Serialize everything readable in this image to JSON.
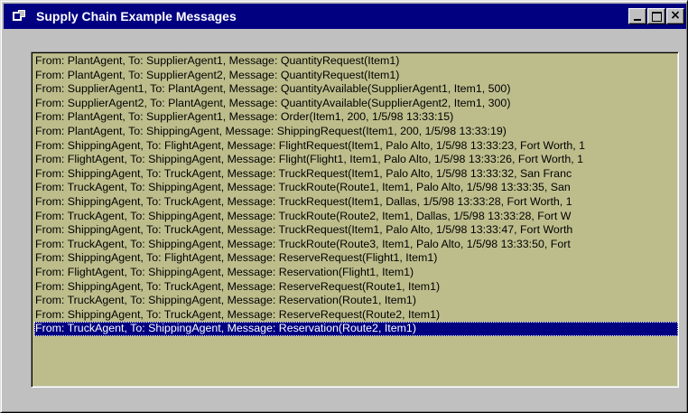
{
  "window": {
    "title": "Supply Chain Example Messages",
    "controls": {
      "minimize": "minimize-icon",
      "maximize": "maximize-icon",
      "close": "close-icon"
    }
  },
  "messages": [
    "From: PlantAgent, To: SupplierAgent1, Message: QuantityRequest(Item1)",
    "From: PlantAgent, To: SupplierAgent2, Message: QuantityRequest(Item1)",
    "From: SupplierAgent1, To: PlantAgent, Message: QuantityAvailable(SupplierAgent1, Item1, 500)",
    "From: SupplierAgent2, To: PlantAgent, Message: QuantityAvailable(SupplierAgent2, Item1, 300)",
    "From: PlantAgent, To: SupplierAgent1, Message: Order(Item1, 200, 1/5/98 13:33:15)",
    "From: PlantAgent, To: ShippingAgent, Message: ShippingRequest(Item1, 200, 1/5/98 13:33:19)",
    "From: ShippingAgent, To: FlightAgent, Message: FlightRequest(Item1, Palo Alto, 1/5/98 13:33:23, Fort Worth, 1",
    "From: FlightAgent, To: ShippingAgent, Message: Flight(Flight1, Item1, Palo Alto, 1/5/98 13:33:26, Fort Worth, 1",
    "From: ShippingAgent, To: TruckAgent, Message: TruckRequest(Item1, Palo Alto, 1/5/98 13:33:32, San Franc",
    "From: TruckAgent, To: ShippingAgent, Message: TruckRoute(Route1, Item1, Palo Alto, 1/5/98 13:33:35, San",
    "From: ShippingAgent, To: TruckAgent, Message: TruckRequest(Item1, Dallas, 1/5/98 13:33:28, Fort Worth, 1",
    "From: TruckAgent, To: ShippingAgent, Message: TruckRoute(Route2, Item1, Dallas, 1/5/98 13:33:28, Fort W",
    "From: ShippingAgent, To: TruckAgent, Message: TruckRequest(Item1, Palo Alto, 1/5/98 13:33:47, Fort Worth",
    "From: TruckAgent, To: ShippingAgent, Message: TruckRoute(Route3, Item1, Palo Alto, 1/5/98 13:33:50, Fort",
    "From: ShippingAgent, To: FlightAgent, Message: ReserveRequest(Flight1, Item1)",
    "From: FlightAgent, To: ShippingAgent, Message: Reservation(Flight1, Item1)",
    "From: ShippingAgent, To: TruckAgent, Message: ReserveRequest(Route1, Item1)",
    "From: TruckAgent, To: ShippingAgent, Message: Reservation(Route1, Item1)",
    "From: ShippingAgent, To: TruckAgent, Message: ReserveRequest(Route2, Item1)",
    "From: TruckAgent, To: ShippingAgent, Message: Reservation(Route2, Item1)"
  ],
  "selected_index": 19,
  "colors": {
    "titlebar": "#000080",
    "list_background": "#bdbd8c",
    "selection": "#000080",
    "window_face": "#c0c0c0"
  }
}
